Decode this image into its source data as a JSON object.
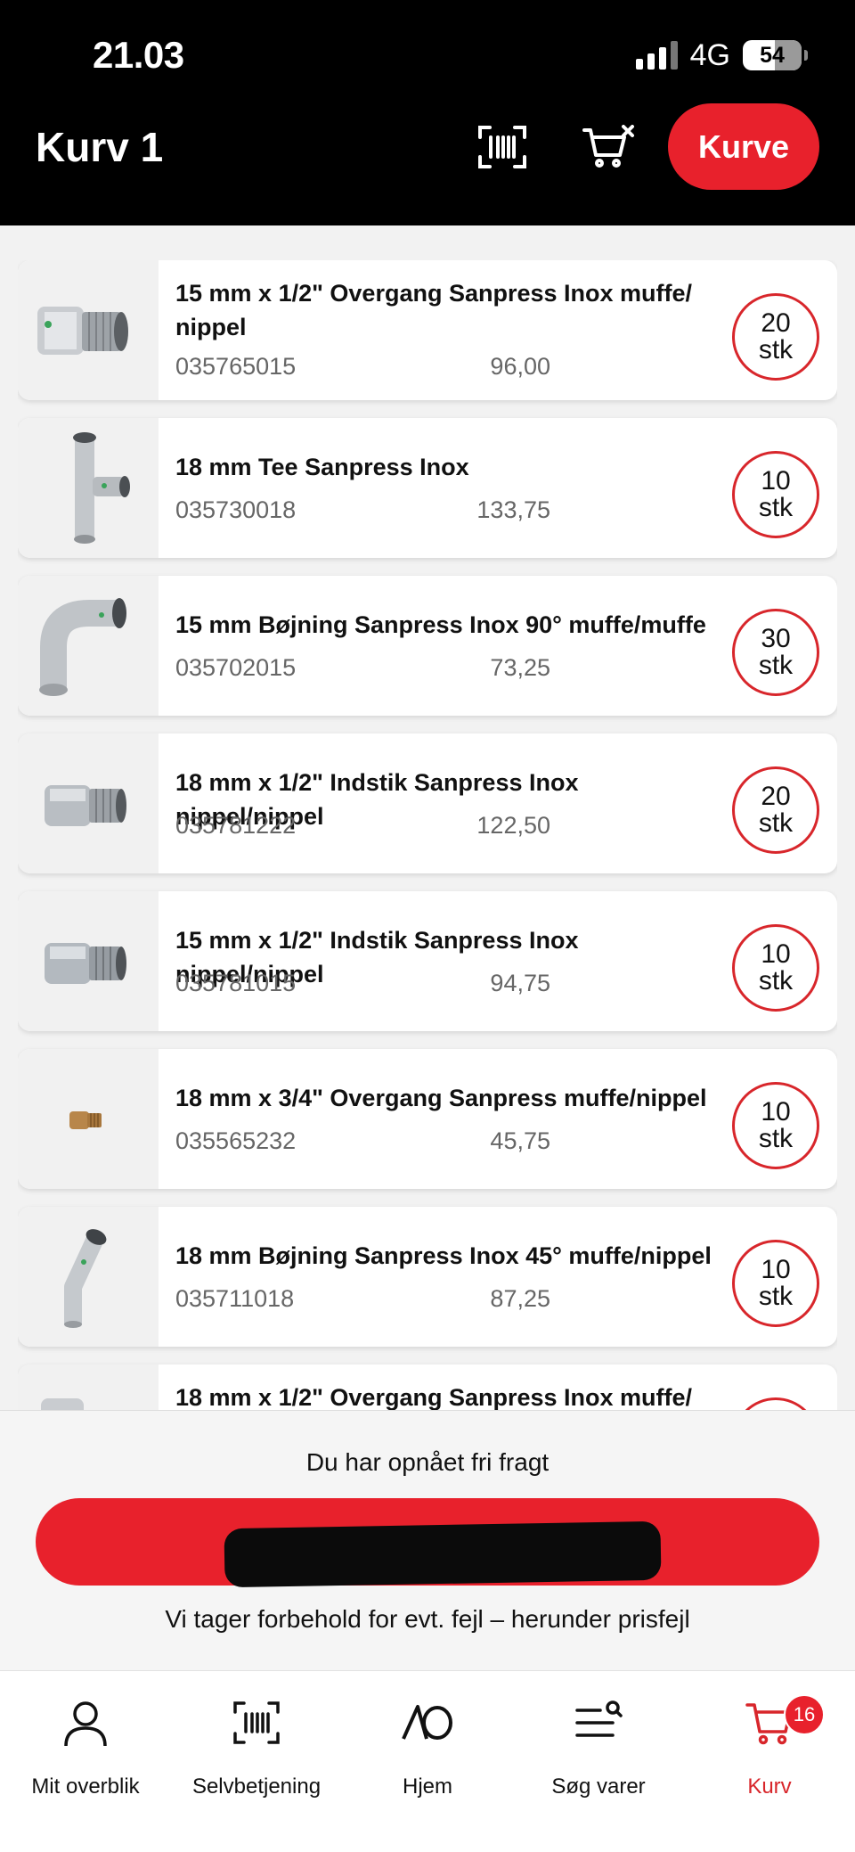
{
  "status_bar": {
    "time": "21.03",
    "network": "4G",
    "battery": "54"
  },
  "header": {
    "title": "Kurv 1",
    "kurve_button": "Kurve"
  },
  "colors": {
    "brand_red": "#e8212c",
    "header_bg": "#000000"
  },
  "items": [
    {
      "name": "15 mm x 1/2\" Overgang Sanpress Inox muffe/ nippel",
      "number": "035765015",
      "price": "96,00",
      "qty": "20",
      "unit": "stk"
    },
    {
      "name": "18 mm Tee Sanpress Inox",
      "number": "035730018",
      "price": "133,75",
      "qty": "10",
      "unit": "stk"
    },
    {
      "name": "15 mm Bøjning Sanpress Inox 90° muffe/muffe",
      "number": "035702015",
      "price": "73,25",
      "qty": "30",
      "unit": "stk"
    },
    {
      "name": "18 mm x 1/2\" Indstik Sanpress Inox nippel/nippel",
      "number": "035781222",
      "price": "122,50",
      "qty": "20",
      "unit": "stk"
    },
    {
      "name": "15 mm x 1/2\" Indstik Sanpress Inox nippel/nippel",
      "number": "035781015",
      "price": "94,75",
      "qty": "10",
      "unit": "stk"
    },
    {
      "name": "18 mm x 3/4\" Overgang Sanpress muffe/nippel",
      "number": "035565232",
      "price": "45,75",
      "qty": "10",
      "unit": "stk"
    },
    {
      "name": "18 mm Bøjning Sanpress Inox 45° muffe/nippel",
      "number": "035711018",
      "price": "87,25",
      "qty": "10",
      "unit": "stk"
    },
    {
      "name": "18 mm x 1/2\" Overgang Sanpress Inox muffe/",
      "number": "",
      "price": "",
      "qty": "",
      "unit": ""
    }
  ],
  "footer": {
    "free_freight": "Du har opnået fri fragt",
    "disclaimer": "Vi tager forbehold for evt. fejl – herunder prisfejl"
  },
  "nav": {
    "overview": "Mit overblik",
    "selfservice": "Selvbetjening",
    "home": "Hjem",
    "search": "Søg varer",
    "cart": "Kurv",
    "cart_badge": "16"
  },
  "icons": {
    "barcode": "barcode-icon",
    "clear_cart": "cart-clear-icon",
    "user": "user-icon",
    "home_logo": "ao-logo-icon",
    "search_list": "search-list-icon",
    "cart": "cart-icon"
  }
}
